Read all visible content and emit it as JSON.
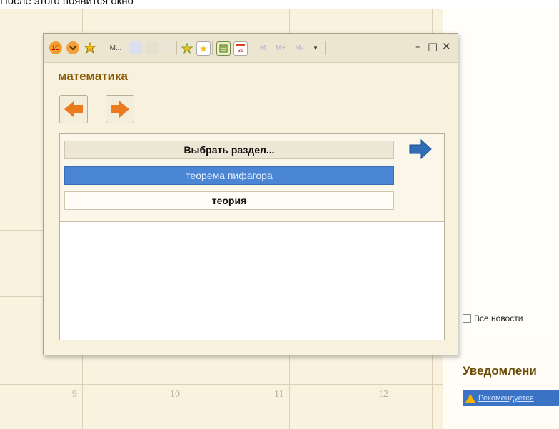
{
  "caption": "После этого появится окно",
  "calendar": {
    "day_numbers": [
      "9",
      "10",
      "11",
      "12"
    ]
  },
  "right_panel": {
    "all_news_label": "Все новости",
    "notifications_title": "Уведомлени",
    "notification_link": "Рекомендуется"
  },
  "window": {
    "toolbar_m_label": "М...",
    "form_title": "математика",
    "sections_header": "Выбрать раздел...",
    "items": [
      "теорема пифагора",
      "теория"
    ],
    "colors": {
      "accent": "#4a86d4",
      "title": "#8b5a06",
      "nav_arrow": "#ee7a1e"
    }
  }
}
